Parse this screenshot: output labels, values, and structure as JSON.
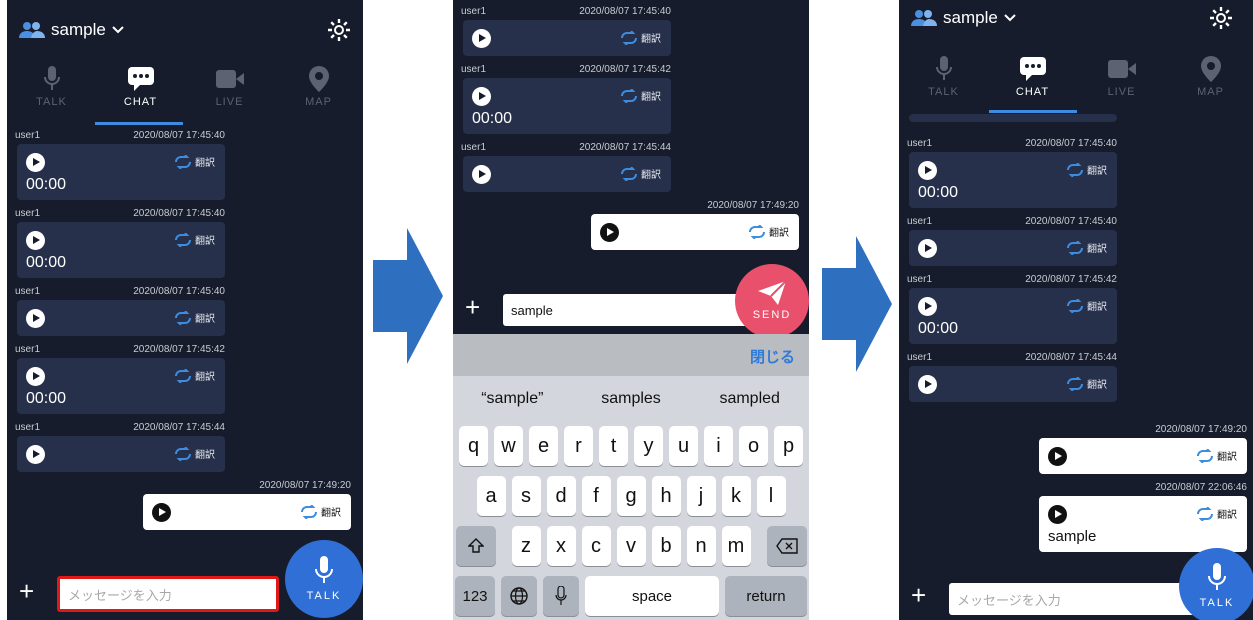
{
  "header": {
    "group_name": "sample"
  },
  "tabs": [
    {
      "id": "talk",
      "label": "TALK"
    },
    {
      "id": "chat",
      "label": "CHAT"
    },
    {
      "id": "live",
      "label": "LIVE"
    },
    {
      "id": "map",
      "label": "MAP"
    }
  ],
  "translate_label": "翻訳",
  "input_placeholder": "メッセージを入力",
  "talk_button_label": "TALK",
  "send_button_label": "SEND",
  "screen1": {
    "messages": [
      {
        "user": "user1",
        "timestamp": "2020/08/07 17:45:40",
        "duration": "00:00"
      },
      {
        "user": "user1",
        "timestamp": "2020/08/07 17:45:40",
        "duration": "00:00"
      },
      {
        "user": "user1",
        "timestamp": "2020/08/07 17:45:40",
        "duration": ""
      },
      {
        "user": "user1",
        "timestamp": "2020/08/07 17:45:42",
        "duration": "00:00"
      },
      {
        "user": "user1",
        "timestamp": "2020/08/07 17:45:44",
        "duration": ""
      }
    ],
    "own_message": {
      "timestamp": "2020/08/07 17:49:20"
    }
  },
  "screen2": {
    "messages": [
      {
        "user": "user1",
        "timestamp": "2020/08/07 17:45:40",
        "duration": ""
      },
      {
        "user": "user1",
        "timestamp": "2020/08/07 17:45:42",
        "duration": "00:00"
      },
      {
        "user": "user1",
        "timestamp": "2020/08/07 17:45:44",
        "duration": ""
      }
    ],
    "own_message": {
      "timestamp": "2020/08/07 17:49:20"
    },
    "input_value": "sample",
    "close_label": "閉じる",
    "suggestions": [
      "“sample”",
      "samples",
      "sampled"
    ],
    "keyboard": {
      "row1": [
        "q",
        "w",
        "e",
        "r",
        "t",
        "y",
        "u",
        "i",
        "o",
        "p"
      ],
      "row2": [
        "a",
        "s",
        "d",
        "f",
        "g",
        "h",
        "j",
        "k",
        "l"
      ],
      "row3": [
        "z",
        "x",
        "c",
        "v",
        "b",
        "n",
        "m"
      ],
      "numbers_label": "123",
      "space_label": "space",
      "return_label": "return"
    }
  },
  "screen3": {
    "messages": [
      {
        "user": "user1",
        "timestamp": "2020/08/07 17:45:40",
        "duration": "00:00"
      },
      {
        "user": "user1",
        "timestamp": "2020/08/07 17:45:40",
        "duration": ""
      },
      {
        "user": "user1",
        "timestamp": "2020/08/07 17:45:42",
        "duration": "00:00"
      },
      {
        "user": "user1",
        "timestamp": "2020/08/07 17:45:44",
        "duration": ""
      }
    ],
    "own_messages": [
      {
        "timestamp": "2020/08/07 17:49:20",
        "text": ""
      },
      {
        "timestamp": "2020/08/07 22:06:46",
        "text": "sample"
      }
    ]
  },
  "colors": {
    "background": "#161c2b",
    "bubble": "#27304a",
    "accent": "#3d8ce0",
    "send": "#e8506c",
    "highlight": "#e01818",
    "arrow": "#2f6fc0"
  }
}
